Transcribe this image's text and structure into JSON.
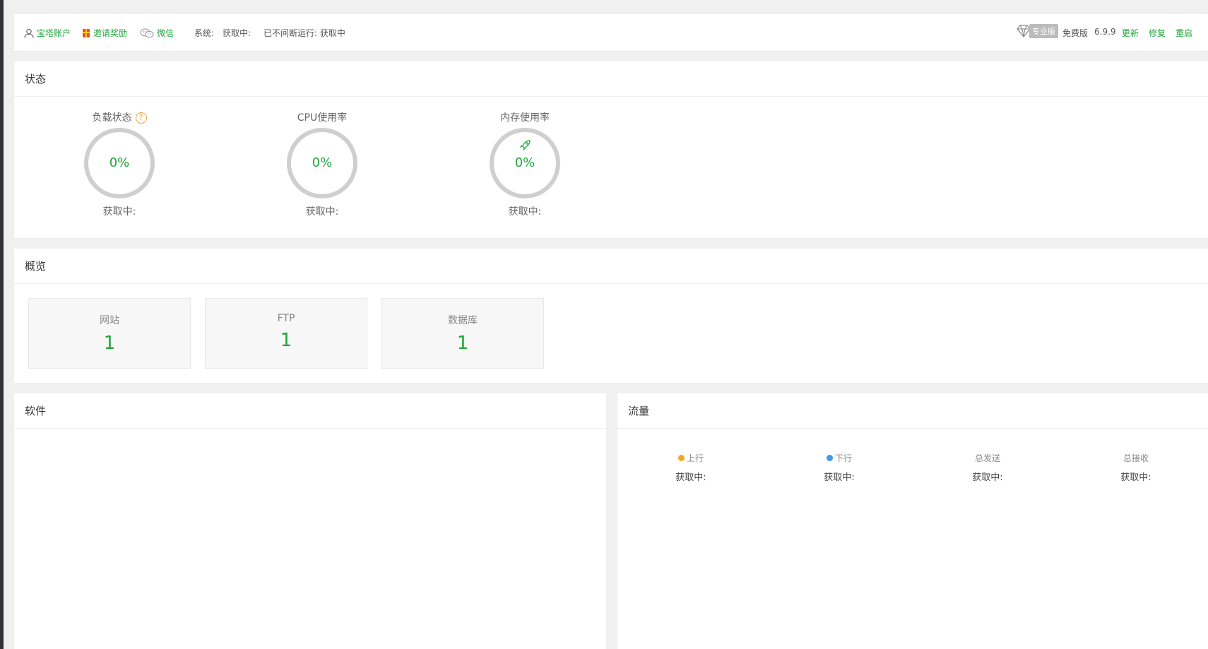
{
  "header": {
    "account": "宝塔账户",
    "invite": "邀请奖励",
    "wechat": "微信",
    "system_label": "系统:",
    "system_value": "获取中:",
    "uptime": "已不间断运行: 获取中",
    "pro_badge": "专业版",
    "edition": "免费版",
    "version": "6.9.9",
    "update": "更新",
    "repair": "修复",
    "restart": "重启"
  },
  "status": {
    "title": "状态",
    "gauges": [
      {
        "label": "负载状态",
        "value": "0%",
        "sub": "获取中:"
      },
      {
        "label": "CPU使用率",
        "value": "0%",
        "sub": "获取中:"
      },
      {
        "label": "内存使用率",
        "value": "0%",
        "sub": "获取中:"
      }
    ],
    "help_icon": "?"
  },
  "overview": {
    "title": "概览",
    "items": [
      {
        "name": "网站",
        "value": "1"
      },
      {
        "name": "FTP",
        "value": "1"
      },
      {
        "name": "数据库",
        "value": "1"
      }
    ]
  },
  "software": {
    "title": "软件"
  },
  "traffic": {
    "title": "流量",
    "columns": [
      {
        "label": "上行",
        "value": "获取中:",
        "dot_color": "#f5a623"
      },
      {
        "label": "下行",
        "value": "获取中:",
        "dot_color": "#3a9bef"
      },
      {
        "label": "总发送",
        "value": "获取中:"
      },
      {
        "label": "总接收",
        "value": "获取中:"
      }
    ]
  },
  "colors": {
    "accent": "#20a53a",
    "ring": "#cfcfcf"
  }
}
